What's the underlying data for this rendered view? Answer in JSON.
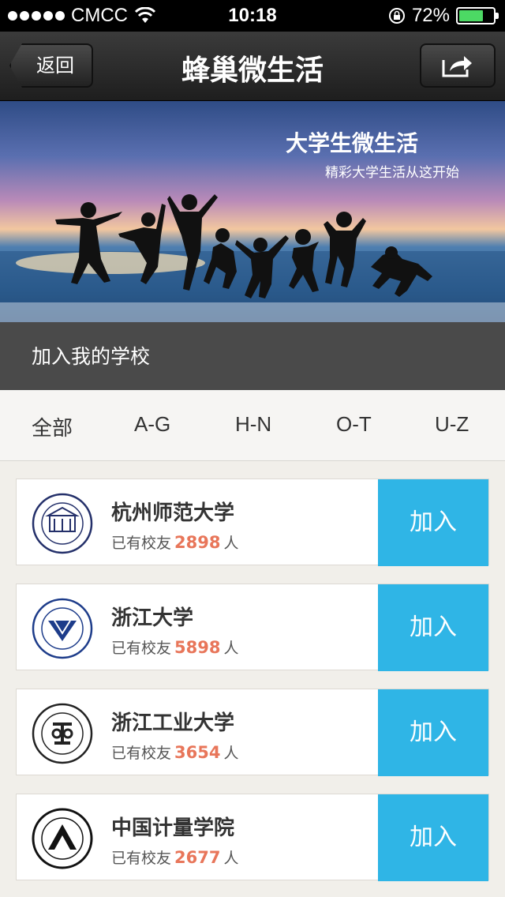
{
  "status": {
    "carrier": "CMCC",
    "time": "10:18",
    "battery": "72%",
    "battery_fraction": 0.72
  },
  "nav": {
    "back_label": "返回",
    "title": "蜂巢微生活"
  },
  "banner": {
    "headline": "大学生微生活",
    "subline": "精彩大学生活从这开始"
  },
  "join_section": {
    "title": "加入我的学校"
  },
  "filters": [
    "全部",
    "A-G",
    "H-N",
    "O-T",
    "U-Z"
  ],
  "alumni_prefix": "已有校友",
  "alumni_suffix": "人",
  "schools": [
    {
      "name": "杭州师范大学",
      "count": "2898",
      "button": "加入"
    },
    {
      "name": "浙江大学",
      "count": "5898",
      "button": "加入"
    },
    {
      "name": "浙江工业大学",
      "count": "3654",
      "button": "加入"
    },
    {
      "name": "中国计量学院",
      "count": "2677",
      "button": "加入"
    }
  ],
  "colors": {
    "accent": "#2fb5e6",
    "count": "#e8765a"
  }
}
